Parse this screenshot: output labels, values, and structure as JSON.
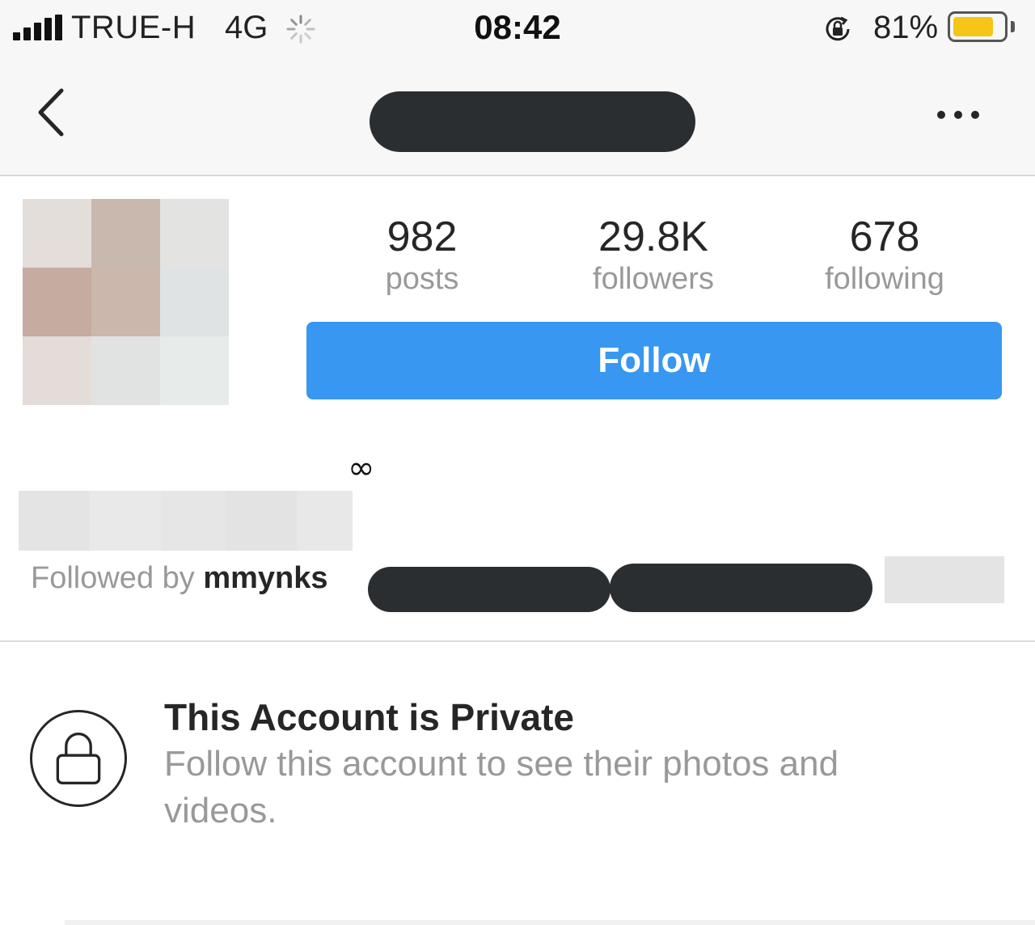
{
  "status_bar": {
    "carrier": "TRUE-H",
    "network": "4G",
    "time": "08:42",
    "battery_percent": "81%",
    "battery_level": 0.81,
    "battery_color": "#f5c518",
    "icons": [
      "signal-icon",
      "loading-spinner-icon",
      "orientation-lock-icon",
      "battery-icon"
    ]
  },
  "nav": {
    "back_icon": "chevron-left-icon",
    "more_icon": "more-horizontal-icon"
  },
  "profile": {
    "stats": [
      {
        "value": "982",
        "label": "posts"
      },
      {
        "value": "29.8K",
        "label": "followers"
      },
      {
        "value": "678",
        "label": "following"
      }
    ],
    "follow_label": "Follow",
    "follow_color": "#3897f0",
    "bio_symbol": "∞",
    "followed_by_prefix": "Followed by ",
    "followed_by_user": "mmynks"
  },
  "private_notice": {
    "title": "This Account is Private",
    "description": "Follow this account to see their photos and videos.",
    "icon": "lock-icon"
  }
}
